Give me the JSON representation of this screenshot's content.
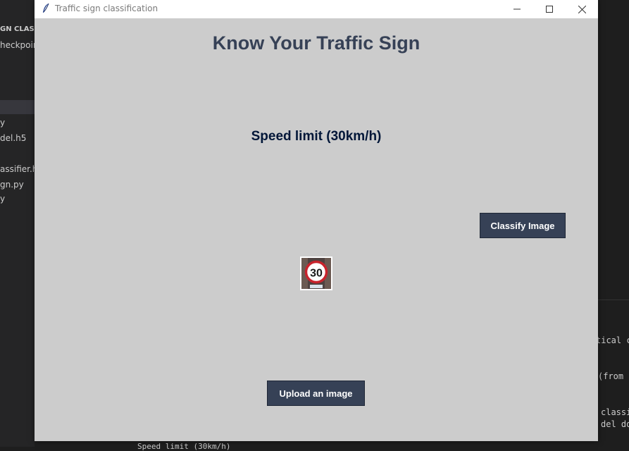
{
  "ide": {
    "sidebar_items": [
      "GN CLASSI",
      "heckpoir",
      "y",
      "del.h5",
      "assifier.h",
      "gn.py",
      "y"
    ],
    "terminal_lines": [
      "tical c",
      "(from t",
      "classi",
      "del doe"
    ],
    "bottom_text": "Speed limit (30km/h)"
  },
  "window": {
    "title": "Traffic sign classification",
    "heading": "Know Your Traffic Sign",
    "result_label": "Speed limit (30km/h)",
    "classify_button": "Classify Image",
    "upload_button": "Upload an image",
    "sign_image": {
      "icon": "speed-limit-30-sign",
      "text": "30"
    }
  },
  "colors": {
    "window_bg": "#cccccc",
    "heading": "#364156",
    "result": "#011638",
    "button_bg": "#364156",
    "button_text": "#ffffff"
  }
}
